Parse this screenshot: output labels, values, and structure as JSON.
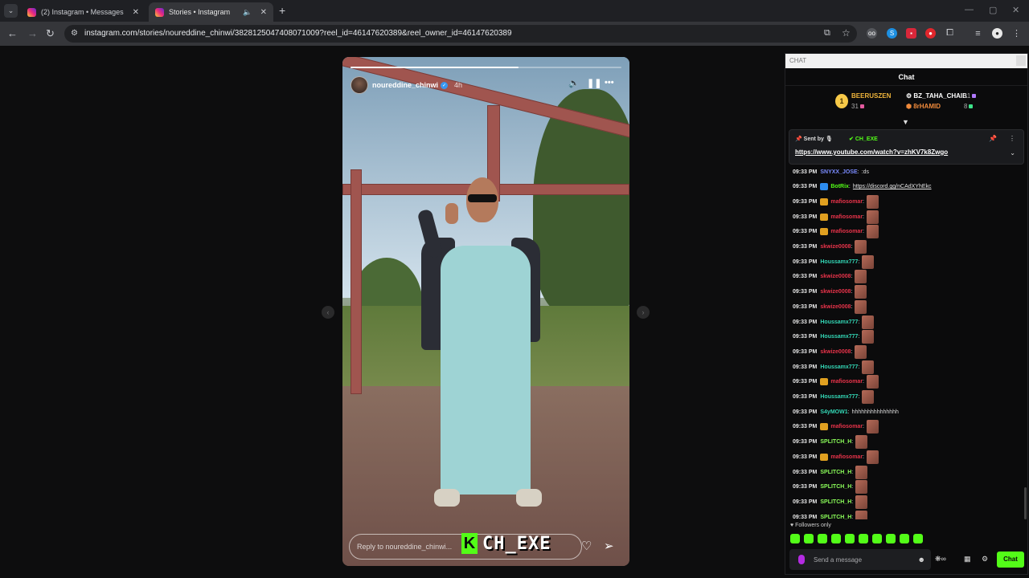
{
  "browser": {
    "tabs": [
      {
        "title": "(2) Instagram • Messages",
        "active": false
      },
      {
        "title": "Stories • Instagram",
        "active": true
      }
    ],
    "url": "instagram.com/stories/noureddine_chinwi/3828125047408071009?reel_id=46147620389&reel_owner_id=46147620389"
  },
  "story": {
    "username": "noureddine_chinwi",
    "time": "4h",
    "reply_placeholder": "Reply to noureddine_chinwi...",
    "progress": 0.62
  },
  "overlay": {
    "logo_letter": "K",
    "channel_name": "CH_EXE"
  },
  "chat": {
    "window_label": "CHAT",
    "title": "Chat",
    "leaderboard": {
      "rank": "1",
      "first": {
        "name": "BEERUSZEN",
        "count": "31"
      },
      "second": {
        "name": "BZ_TAHA_CHAIB",
        "count": "11"
      },
      "third": {
        "name": "8rHAMID",
        "count": "8"
      }
    },
    "pinned": {
      "label": "Sent by",
      "sender": "CH_EXE",
      "link": "https://www.youtube.com/watch?v=zhKV7k8Zwgo"
    },
    "messages": [
      {
        "time": "09:33 PM",
        "user": "SNYXX_JOSE",
        "color": "#7b8cff",
        "text": ":ds",
        "emote": false
      },
      {
        "time": "09:33 PM",
        "user": "BotRix",
        "color": "#53fc18",
        "link": "https://discord.gg/nCAdXYhEkc",
        "emote": false
      },
      {
        "time": "09:33 PM",
        "user": "mafiosomar",
        "color": "#e8334a",
        "emote": true
      },
      {
        "time": "09:33 PM",
        "user": "mafiosomar",
        "color": "#e8334a",
        "emote": true
      },
      {
        "time": "09:33 PM",
        "user": "mafiosomar",
        "color": "#e8334a",
        "emote": true
      },
      {
        "time": "09:33 PM",
        "user": "skwize0008",
        "color": "#e8334a",
        "emote": true
      },
      {
        "time": "09:33 PM",
        "user": "Houssamx777",
        "color": "#33d6b5",
        "emote": true
      },
      {
        "time": "09:33 PM",
        "user": "skwize0008",
        "color": "#e8334a",
        "emote": true
      },
      {
        "time": "09:33 PM",
        "user": "skwize0008",
        "color": "#e8334a",
        "emote": true
      },
      {
        "time": "09:33 PM",
        "user": "skwize0008",
        "color": "#e8334a",
        "emote": true
      },
      {
        "time": "09:33 PM",
        "user": "Houssamx777",
        "color": "#33d6b5",
        "emote": true
      },
      {
        "time": "09:33 PM",
        "user": "Houssamx777",
        "color": "#33d6b5",
        "emote": true
      },
      {
        "time": "09:33 PM",
        "user": "skwize0008",
        "color": "#e8334a",
        "emote": true
      },
      {
        "time": "09:33 PM",
        "user": "Houssamx777",
        "color": "#33d6b5",
        "emote": true
      },
      {
        "time": "09:33 PM",
        "user": "mafiosomar",
        "color": "#e8334a",
        "emote": true
      },
      {
        "time": "09:33 PM",
        "user": "Houssamx777",
        "color": "#33d6b5",
        "emote": true
      },
      {
        "time": "09:33 PM",
        "user": "S4yMOW1",
        "color": "#33d6b5",
        "text": "hhhhhhhhhhhhhhh",
        "emote": false
      },
      {
        "time": "09:33 PM",
        "user": "mafiosomar",
        "color": "#e8334a",
        "emote": true
      },
      {
        "time": "09:33 PM",
        "user": "SPLITCH_H",
        "color": "#8cff5a",
        "emote": true
      },
      {
        "time": "09:33 PM",
        "user": "mafiosomar",
        "color": "#e8334a",
        "emote": true
      },
      {
        "time": "09:33 PM",
        "user": "SPLITCH_H",
        "color": "#8cff5a",
        "emote": true
      },
      {
        "time": "09:33 PM",
        "user": "SPLITCH_H",
        "color": "#8cff5a",
        "emote": true
      },
      {
        "time": "09:33 PM",
        "user": "SPLITCH_H",
        "color": "#8cff5a",
        "emote": true
      },
      {
        "time": "09:33 PM",
        "user": "SPLITCH_H",
        "color": "#8cff5a",
        "emote": true
      }
    ],
    "followers_only": "Followers only",
    "send_placeholder": "Send a message",
    "send_label": "Chat"
  }
}
